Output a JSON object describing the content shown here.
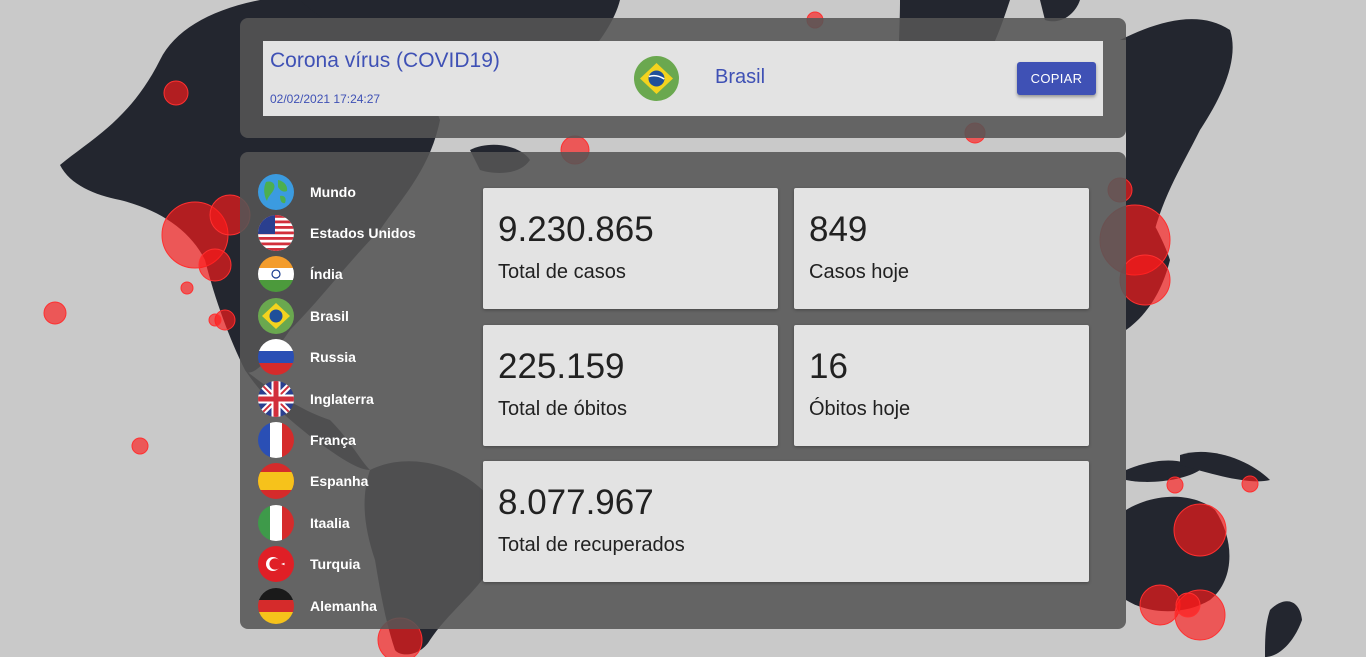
{
  "header": {
    "title": "Corona vírus (COVID19)",
    "datetime": "02/02/2021 17:24:27",
    "selected_country": "Brasil",
    "selected_flag": "flag-brazil-icon",
    "copy_label": "COPIAR"
  },
  "countries": [
    {
      "name": "Mundo",
      "icon": "globe-icon"
    },
    {
      "name": "Estados Unidos",
      "icon": "flag-usa-icon"
    },
    {
      "name": "Índia",
      "icon": "flag-india-icon"
    },
    {
      "name": "Brasil",
      "icon": "flag-brazil-icon"
    },
    {
      "name": "Russia",
      "icon": "flag-russia-icon"
    },
    {
      "name": "Inglaterra",
      "icon": "flag-uk-icon"
    },
    {
      "name": "França",
      "icon": "flag-france-icon"
    },
    {
      "name": "Espanha",
      "icon": "flag-spain-icon"
    },
    {
      "name": "Itaalia",
      "icon": "flag-italy-icon"
    },
    {
      "name": "Turquia",
      "icon": "flag-turkey-icon"
    },
    {
      "name": "Alemanha",
      "icon": "flag-germany-icon"
    }
  ],
  "stats": {
    "total_cases": {
      "value": "9.230.865",
      "label": "Total de casos"
    },
    "cases_today": {
      "value": "849",
      "label": "Casos hoje"
    },
    "total_deaths": {
      "value": "225.159",
      "label": "Total de óbitos"
    },
    "deaths_today": {
      "value": "16",
      "label": "Óbitos hoje"
    },
    "recovered": {
      "value": "8.077.967",
      "label": "Total de recuperados"
    }
  },
  "colors": {
    "accent": "#3f51b5",
    "panel": "#555555",
    "card": "#e3e3e3",
    "map_land": "#23262f",
    "hotspot": "#ff1a1a"
  }
}
